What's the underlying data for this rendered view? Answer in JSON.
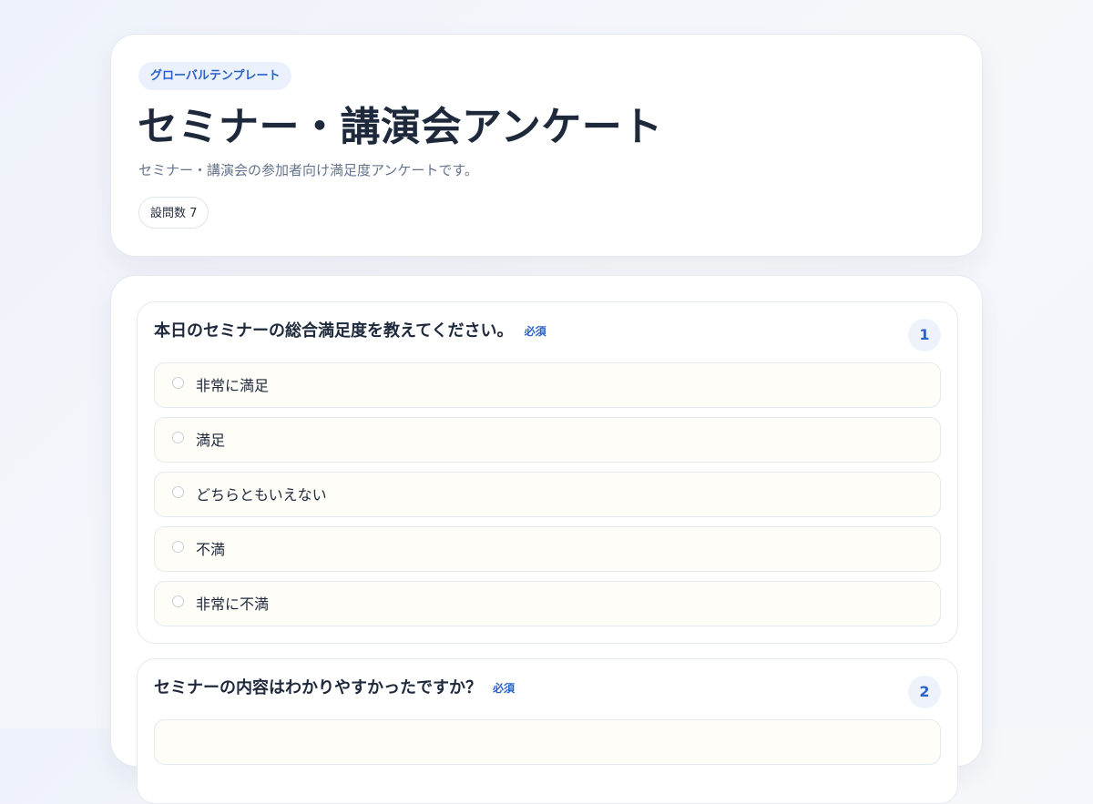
{
  "header": {
    "template_badge": "グローバルテンプレート",
    "title": "セミナー・講演会アンケート",
    "description": "セミナー・講演会の参加者向け満足度アンケートです。",
    "question_count": "設問数 7"
  },
  "questions": [
    {
      "number": "1",
      "title": "本日のセミナーの総合満足度を教えてください。",
      "required_label": "必須",
      "options": [
        "非常に満足",
        "満足",
        "どちらともいえない",
        "不満",
        "非常に不満"
      ]
    },
    {
      "number": "2",
      "title": "セミナーの内容はわかりやすかったですか？",
      "required_label": "必須",
      "options": []
    }
  ],
  "colors": {
    "accent": "#2a62c9",
    "text": "#1e293b",
    "muted": "#64748b",
    "option_bg": "#fffdf8",
    "badge_bg": "#eaf1fd"
  }
}
